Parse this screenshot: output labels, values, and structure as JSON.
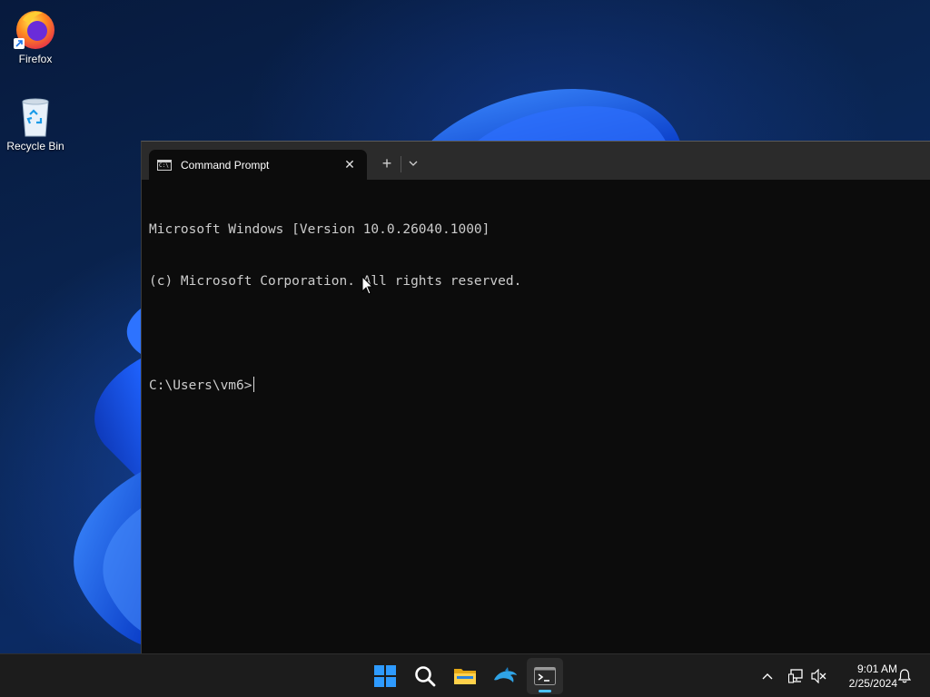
{
  "desktop": {
    "icons": [
      {
        "label": "Firefox"
      },
      {
        "label": "Recycle Bin"
      }
    ]
  },
  "terminal": {
    "tab_title": "Command Prompt",
    "tab_icon_text": "C:\\",
    "close_glyph": "✕",
    "new_tab_glyph": "+",
    "lines": [
      "Microsoft Windows [Version 10.0.26040.1000]",
      "(c) Microsoft Corporation. All rights reserved.",
      "",
      "C:\\Users\\vm6>"
    ],
    "background_color": "#0c0c0c",
    "text_color": "#cccccc"
  },
  "taskbar": {
    "apps": [
      {
        "name": "Start"
      },
      {
        "name": "Search"
      },
      {
        "name": "File Explorer"
      },
      {
        "name": "Dolphin"
      },
      {
        "name": "Terminal",
        "active": true
      }
    ],
    "tray": {
      "time": "9:01 AM",
      "date": "2/25/2024"
    },
    "accent_color": "#4cc2ff"
  }
}
